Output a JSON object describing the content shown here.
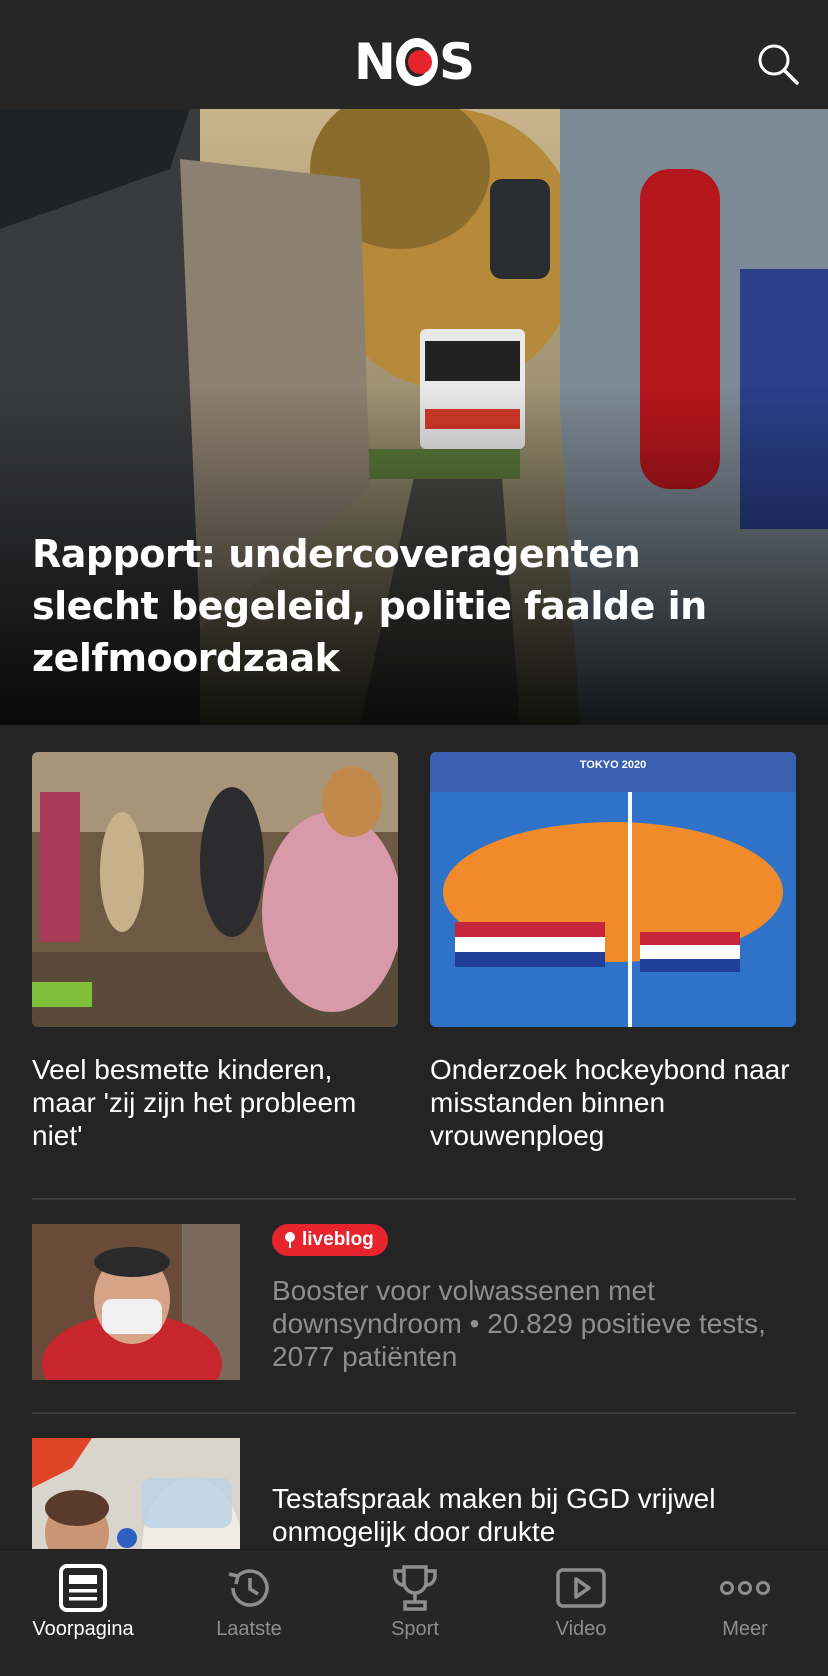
{
  "header": {
    "logo_text": "NOS",
    "search_icon": "search-icon"
  },
  "hero": {
    "headline": "Rapport: undercoveragenten slecht begeleid, politie faalde in zelfmoordzaak"
  },
  "cards": [
    {
      "title": "Veel besmette kinderen, maar 'zij zijn het probleem niet'"
    },
    {
      "title": "Onderzoek hockeybond naar misstanden binnen vrouwenploeg",
      "image_text": "TOKYO 2020"
    }
  ],
  "list": [
    {
      "badge": "liveblog",
      "badge_icon": "pin-icon",
      "title": "Booster voor volwassenen met downsyndroom • 20.829 positieve tests, 2077 patiënten"
    },
    {
      "title": "Testafspraak maken bij GGD vrijwel onmogelijk door drukte"
    }
  ],
  "tabs": [
    {
      "label": "Voorpagina",
      "icon": "newspaper-icon",
      "active": true
    },
    {
      "label": "Laatste",
      "icon": "history-icon",
      "active": false
    },
    {
      "label": "Sport",
      "icon": "trophy-icon",
      "active": false
    },
    {
      "label": "Video",
      "icon": "play-icon",
      "active": false
    },
    {
      "label": "Meer",
      "icon": "more-icon",
      "active": false
    }
  ],
  "colors": {
    "background": "#242424",
    "accent_red": "#e6242b",
    "muted_text": "#8e8e8e"
  }
}
